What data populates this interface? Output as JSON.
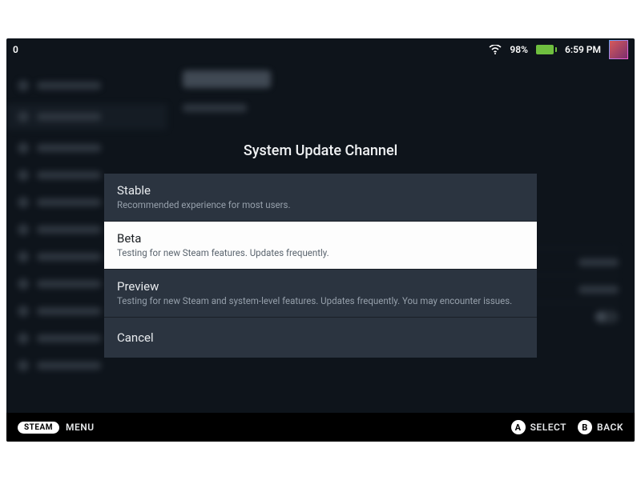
{
  "status": {
    "notification_count": "0",
    "battery_pct": "98%",
    "time": "6:59 PM"
  },
  "modal": {
    "title": "System Update Channel",
    "options": [
      {
        "label": "Stable",
        "desc": "Recommended experience for most users."
      },
      {
        "label": "Beta",
        "desc": "Testing for new Steam features. Updates frequently."
      },
      {
        "label": "Preview",
        "desc": "Testing for new Steam and system-level features. Updates frequently. You may encounter issues."
      },
      {
        "label": "Cancel",
        "desc": ""
      }
    ],
    "selected_index": 1
  },
  "hints": {
    "steam": "STEAM",
    "menu": "MENU",
    "select_btn": "A",
    "select_label": "SELECT",
    "back_btn": "B",
    "back_label": "BACK"
  }
}
